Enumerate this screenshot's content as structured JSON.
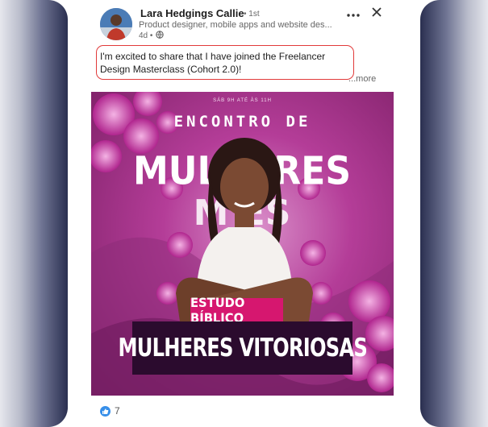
{
  "author": {
    "name": "Lara Hedgings Callie",
    "degree": "• 1st",
    "headline": "Product designer, mobile apps and website des...",
    "time": "4d •"
  },
  "post": {
    "text": "I'm excited to share that I have joined the Freelancer Design Masterclass (Cohort 2.0)!",
    "see_more": "...more"
  },
  "poster": {
    "date_line": "SÁB 9H ATÉ ÀS 11H",
    "top_title": "ENCONTRO DE",
    "big_word": "MULHERES",
    "tag": "ESTUDO BÍBLICO",
    "bottom_title": "MULHERES VITORIOSAS",
    "accent": "#d6176f",
    "dark_bar": "#2b0b2e"
  },
  "social": {
    "reaction_count": "7",
    "reaction_icon": "like-icon"
  },
  "icons": [
    "more-icon",
    "close-icon",
    "globe-icon"
  ],
  "colors": {
    "highlight_border": "#e13a3a",
    "like_blue": "#378fe9"
  }
}
